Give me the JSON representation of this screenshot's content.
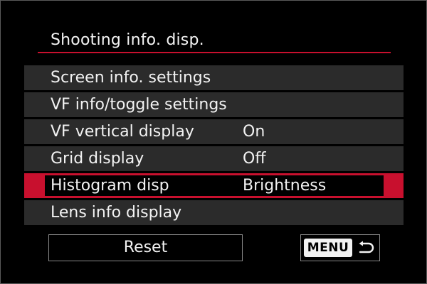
{
  "header": {
    "title": "Shooting info. disp."
  },
  "menu": {
    "items": [
      {
        "label": "Screen info. settings",
        "value": ""
      },
      {
        "label": "VF info/toggle settings",
        "value": ""
      },
      {
        "label": "VF vertical display",
        "value": "On"
      },
      {
        "label": "Grid display",
        "value": "Off"
      },
      {
        "label": "Histogram disp",
        "value": "Brightness"
      },
      {
        "label": "Lens info display",
        "value": ""
      }
    ],
    "selected_index": 4
  },
  "footer": {
    "reset_label": "Reset",
    "menu_label": "MENU",
    "return_icon": "return-arrow-icon"
  },
  "colors": {
    "accent": "#c8102e",
    "row_background": "#2b2b2b",
    "screen_background": "#000000"
  }
}
